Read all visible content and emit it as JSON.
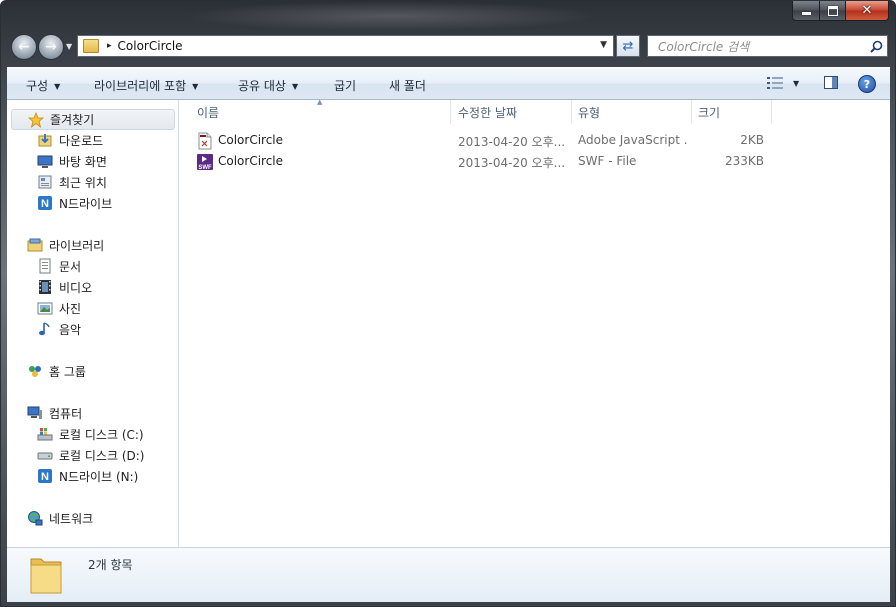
{
  "window": {
    "buttons": [
      "minimize",
      "maximize",
      "close"
    ]
  },
  "nav": {
    "breadcrumb_arrow": "▸",
    "address": "ColorCircle",
    "search_placeholder": "ColorCircle 검색"
  },
  "toolbar": {
    "organize": "구성",
    "include_library": "라이브러리에 포함",
    "share_with": "공유 대상",
    "burn": "굽기",
    "new_folder": "새 폴더"
  },
  "sidebar": {
    "favorites": {
      "label": "즐겨찾기",
      "items": [
        {
          "label": "다운로드",
          "icon": "download-folder-icon"
        },
        {
          "label": "바탕 화면",
          "icon": "desktop-icon"
        },
        {
          "label": "최근 위치",
          "icon": "recent-places-icon"
        },
        {
          "label": "N드라이브",
          "icon": "ndrive-icon"
        }
      ]
    },
    "libraries": {
      "label": "라이브러리",
      "items": [
        {
          "label": "문서",
          "icon": "documents-icon"
        },
        {
          "label": "비디오",
          "icon": "videos-icon"
        },
        {
          "label": "사진",
          "icon": "pictures-icon"
        },
        {
          "label": "음악",
          "icon": "music-icon"
        }
      ]
    },
    "homegroup": {
      "label": "홈 그룹"
    },
    "computer": {
      "label": "컴퓨터",
      "items": [
        {
          "label": "로컬 디스크 (C:)",
          "icon": "system-drive-icon"
        },
        {
          "label": "로컬 디스크 (D:)",
          "icon": "drive-icon"
        },
        {
          "label": "N드라이브 (N:)",
          "icon": "ndrive-icon"
        }
      ]
    },
    "network": {
      "label": "네트워크"
    }
  },
  "columns": [
    "이름",
    "수정한 날짜",
    "유형",
    "크기"
  ],
  "files": [
    {
      "name": "ColorCircle",
      "date": "2013-04-20 오후...",
      "type": "Adobe JavaScript ...",
      "size": "2KB",
      "icon": "jsx-file-icon"
    },
    {
      "name": "ColorCircle",
      "date": "2013-04-20 오후...",
      "type": "SWF - File",
      "size": "233KB",
      "icon": "swf-file-icon"
    }
  ],
  "status": {
    "item_count": "2개 항목"
  },
  "colors": {
    "toolbar": "#dde8f4",
    "frame": "#4a5058",
    "close": "#c7462f",
    "selection": "#e4e9ef"
  }
}
